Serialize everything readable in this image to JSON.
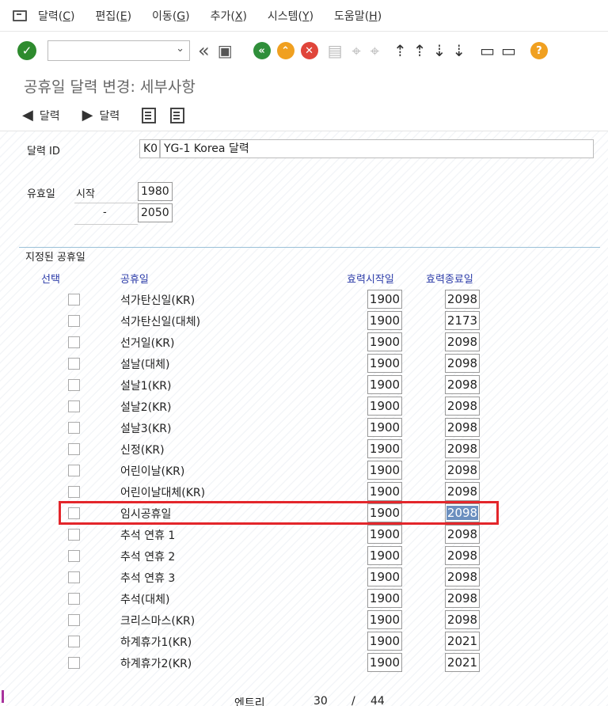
{
  "menubar": {
    "items": [
      {
        "label": "달력",
        "mnemonic": "C"
      },
      {
        "label": "편집",
        "mnemonic": "E"
      },
      {
        "label": "이동",
        "mnemonic": "G"
      },
      {
        "label": "추가",
        "mnemonic": "X"
      },
      {
        "label": "시스템",
        "mnemonic": "Y"
      },
      {
        "label": "도움말",
        "mnemonic": "H"
      }
    ]
  },
  "toolbar": {
    "command_value": "",
    "icons": [
      "enter-icon",
      "back-double-icon",
      "save-icon",
      "back-icon",
      "exit-icon",
      "cancel-icon",
      "print-icon",
      "find-icon",
      "find-next-icon",
      "first-page-icon",
      "previous-page-icon",
      "next-page-icon",
      "last-page-icon",
      "create-session-icon",
      "shortcut-icon",
      "help-icon"
    ]
  },
  "title": "공휴일 달력 변경: 세부사항",
  "nav": {
    "prev_label": "달력",
    "next_label": "달력"
  },
  "header": {
    "calendar_id_label": "달력 ID",
    "calendar_id": "K0",
    "calendar_name": "YG-1 Korea 달력",
    "validity_label": "유효일",
    "start_label": "시작",
    "start_year": "1980",
    "dash": "-",
    "end_year": "2050"
  },
  "group": {
    "title": "지정된 공휴일",
    "columns": [
      "선택",
      "공휴일",
      "효력시작일",
      "효력종료일"
    ],
    "rows": [
      {
        "name": "석가탄신일(KR)",
        "start": "1900",
        "end": "2098"
      },
      {
        "name": "석가탄신일(대체)",
        "start": "1900",
        "end": "2173"
      },
      {
        "name": "선거일(KR)",
        "start": "1900",
        "end": "2098"
      },
      {
        "name": "설날(대체)",
        "start": "1900",
        "end": "2098"
      },
      {
        "name": "설날1(KR)",
        "start": "1900",
        "end": "2098"
      },
      {
        "name": "설날2(KR)",
        "start": "1900",
        "end": "2098"
      },
      {
        "name": "설날3(KR)",
        "start": "1900",
        "end": "2098"
      },
      {
        "name": "신정(KR)",
        "start": "1900",
        "end": "2098"
      },
      {
        "name": "어린이날(KR)",
        "start": "1900",
        "end": "2098"
      },
      {
        "name": "어린이날대체(KR)",
        "start": "1900",
        "end": "2098"
      },
      {
        "name": "임시공휴일",
        "start": "1900",
        "end": "2098"
      },
      {
        "name": "추석 연휴 1",
        "start": "1900",
        "end": "2098"
      },
      {
        "name": "추석 연휴 2",
        "start": "1900",
        "end": "2098"
      },
      {
        "name": "추석 연휴 3",
        "start": "1900",
        "end": "2098"
      },
      {
        "name": "추석(대체)",
        "start": "1900",
        "end": "2098"
      },
      {
        "name": "크리스마스(KR)",
        "start": "1900",
        "end": "2098"
      },
      {
        "name": "하계휴가1(KR)",
        "start": "1900",
        "end": "2021"
      },
      {
        "name": "하계휴가2(KR)",
        "start": "1900",
        "end": "2021"
      }
    ]
  },
  "footer": {
    "entry_label": "엔트리",
    "current": "30",
    "sep": "/",
    "total": "44"
  },
  "colors": {
    "highlight": "#e3262b",
    "column_header": "#2a3aa8",
    "ok_green": "#2e8b2e",
    "nav_green": "#2f8f3a",
    "exit_orange": "#f0a020",
    "cancel_red": "#e0453a"
  }
}
